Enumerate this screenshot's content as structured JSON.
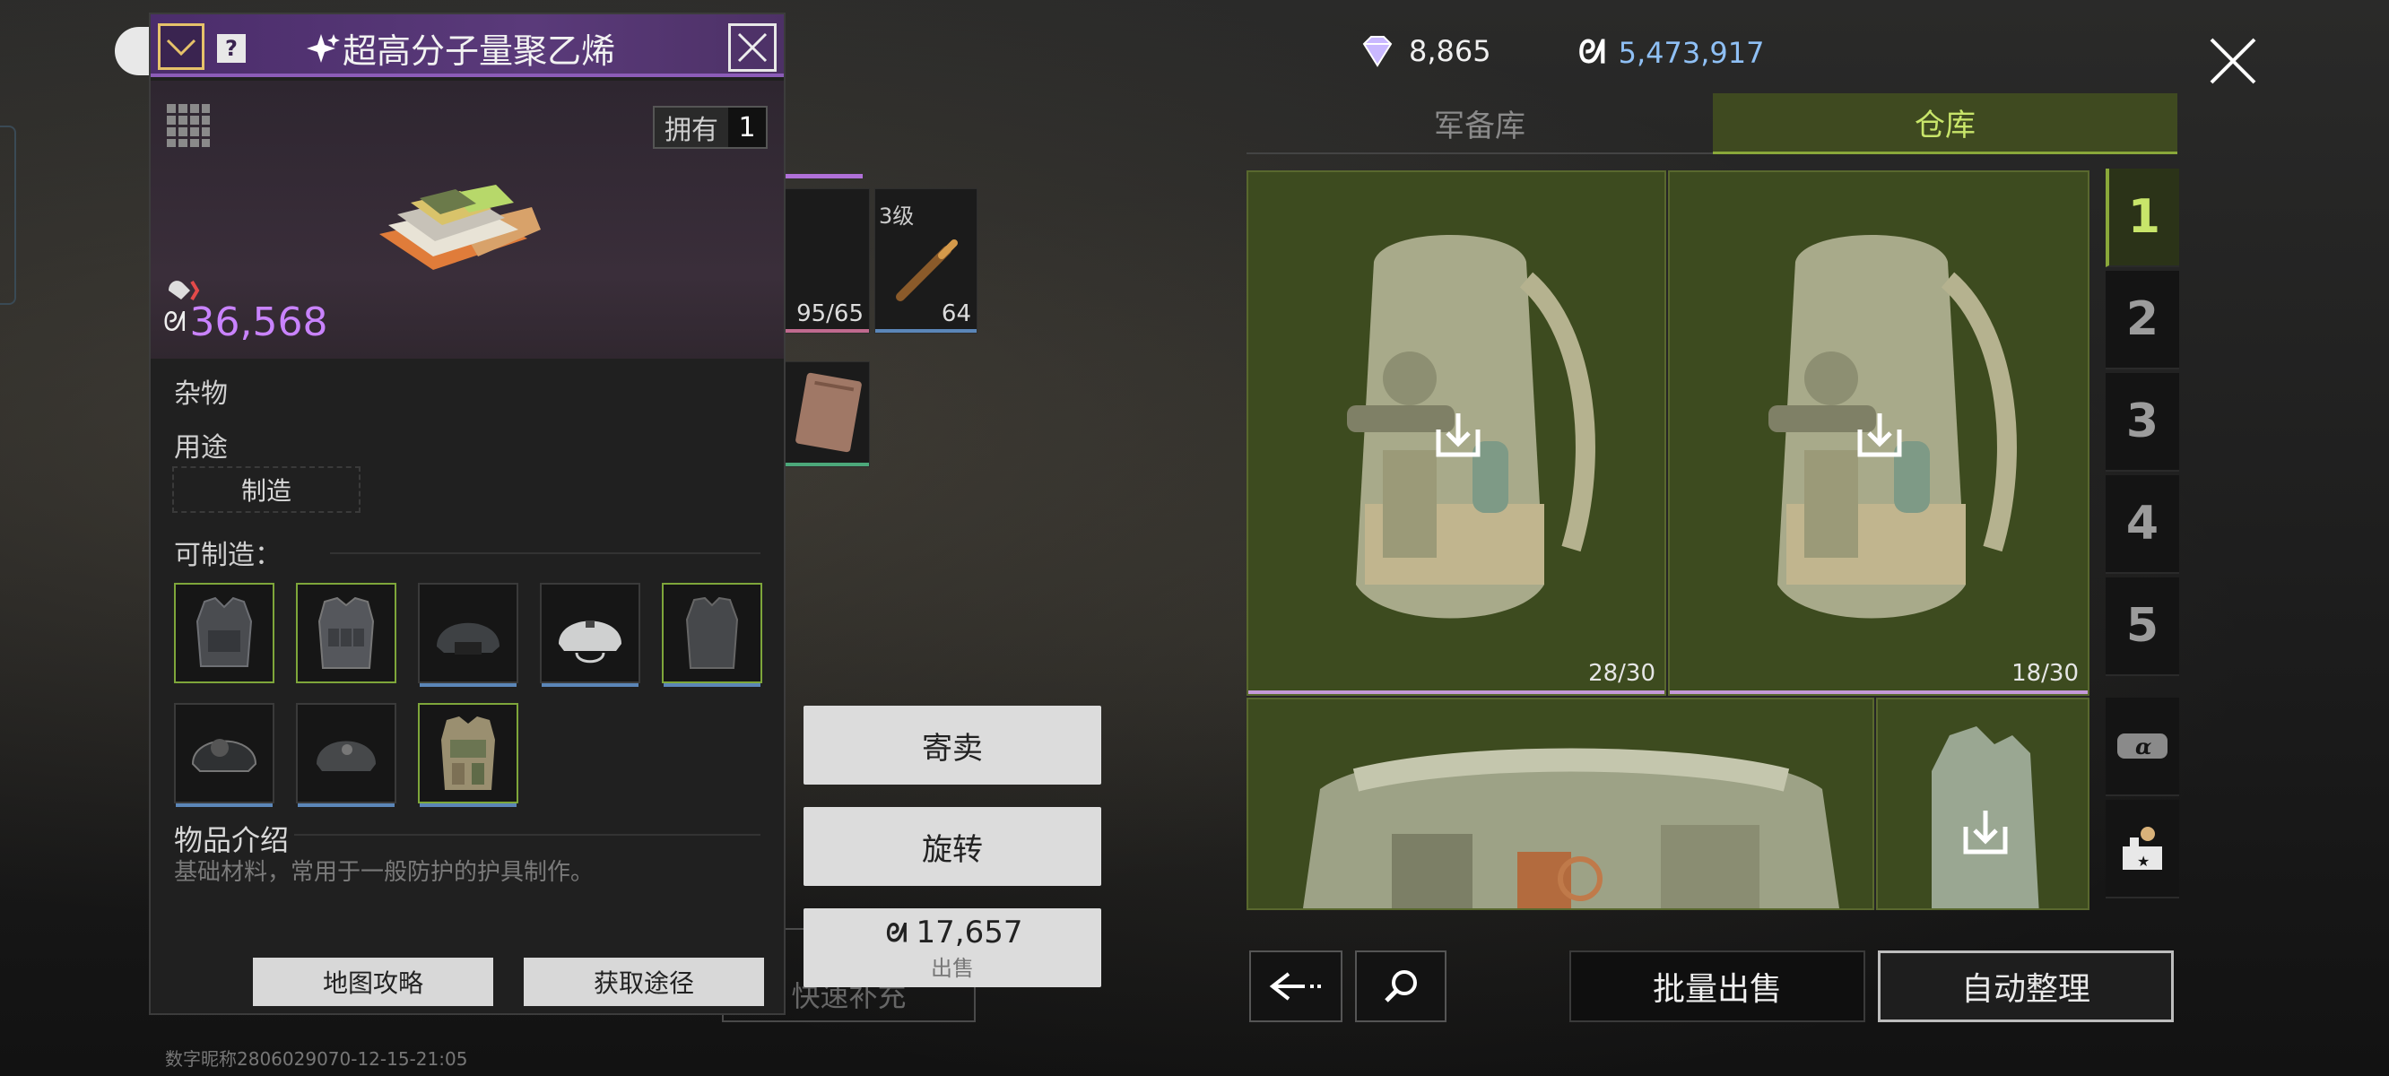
{
  "currency": {
    "diamond_icon": "diamond-icon",
    "diamonds": "8,865",
    "coin_icon": "coin-icon",
    "coins": "5,473,917"
  },
  "tabs": [
    {
      "label": "军备库",
      "active": false
    },
    {
      "label": "仓库",
      "active": true
    }
  ],
  "warehouse": {
    "slots": [
      {
        "name": "backpack",
        "count": "28/30"
      },
      {
        "name": "backpack",
        "count": "18/30"
      },
      {
        "name": "chest-rig"
      },
      {
        "name": "armor-vest"
      }
    ]
  },
  "side_tabs": [
    "1",
    "2",
    "3",
    "4",
    "5"
  ],
  "side_icons": [
    "alpha-case-icon",
    "workbench-icon"
  ],
  "bottom_buttons": {
    "back_icon": "back-arrow-icon",
    "search_icon": "search-icon",
    "bulk_sell": "批量出售",
    "auto_sort": "自动整理"
  },
  "background_items": {
    "ammo_level": "3级",
    "ammo_count": "64",
    "durability": "95/65"
  },
  "actions": {
    "consign": "寄卖",
    "rotate": "旋转",
    "sell_price": "17,657",
    "sell_label": "出售",
    "quick_fill": "快速补充"
  },
  "popup": {
    "title": "超高分子量聚乙烯",
    "own_label": "拥有",
    "own_count": "1",
    "price": "36,568",
    "category": "杂物",
    "usage_label": "用途",
    "usage_value": "制造",
    "craftable_label": "可制造：",
    "craftables": [
      {
        "name": "tactical-vest",
        "frame": "green"
      },
      {
        "name": "plate-carrier",
        "frame": "green"
      },
      {
        "name": "tactical-helmet",
        "frame": "blue"
      },
      {
        "name": "fast-helmet",
        "frame": "blue"
      },
      {
        "name": "armor-vest",
        "frame": "green"
      },
      {
        "name": "combat-helmet",
        "frame": "blue"
      },
      {
        "name": "ballistic-helmet",
        "frame": "blue"
      },
      {
        "name": "camo-plate-carrier",
        "frame": "green"
      }
    ],
    "intro_title": "物品介绍",
    "intro_text": "基础材料，常用于一般防护的护具制作。",
    "map_guide": "地图攻略",
    "acquire": "获取途径",
    "accent": "#5a3a7a",
    "price_color": "#c983ff"
  },
  "watermark": "数字昵称2806029070-12-15-21:05"
}
